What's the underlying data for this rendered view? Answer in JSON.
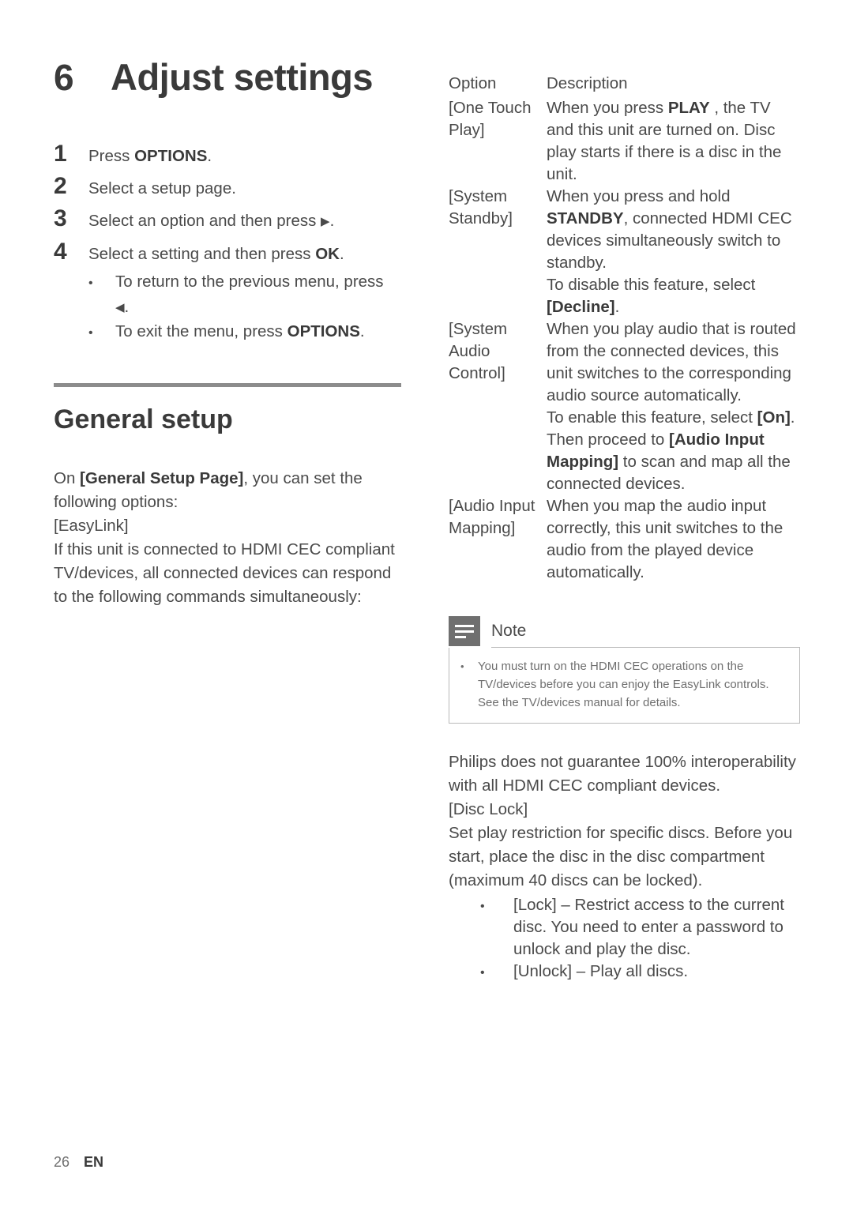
{
  "chapter": {
    "number": "6",
    "title": "Adjust settings"
  },
  "steps": [
    {
      "num": "1",
      "text_before": "Press ",
      "bold": "OPTIONS",
      "text_after": "."
    },
    {
      "num": "2",
      "text_before": "Select a setup page.",
      "bold": "",
      "text_after": ""
    },
    {
      "num": "3",
      "text_before": "Select an option and then press ",
      "bold": "",
      "text_after": "."
    },
    {
      "num": "4",
      "text_before": "Select a setting and then press ",
      "bold": "OK",
      "text_after": "."
    }
  ],
  "step_bullets": [
    {
      "text": "To return to the previous menu, press",
      "second_line": "."
    },
    {
      "text_before": "To exit the menu, press ",
      "bold": "OPTIONS",
      "text_after": "."
    }
  ],
  "section": {
    "title": "General setup",
    "intro_before": "On ",
    "intro_bold": "[General Setup Page]",
    "intro_after": ", you can set the following options:",
    "easylink_label": "[EasyLink]",
    "easylink_body": "If this unit is connected to HDMI CEC compliant TV/devices, all connected devices can respond to the following commands simultaneously:"
  },
  "option_table": {
    "headers": [
      "Option",
      "Description"
    ],
    "rows": [
      {
        "option": "[One Touch Play]",
        "description_parts": [
          {
            "t": "When you press ",
            "b": false
          },
          {
            "t": "PLAY",
            "b": true
          },
          {
            "t": " , the TV and this unit are turned on. Disc play starts if there is a disc in the unit.",
            "b": false
          }
        ]
      },
      {
        "option": "[System Standby]",
        "description_parts": [
          {
            "t": "When you press and hold ",
            "b": false
          },
          {
            "t": "STANDBY",
            "b": true
          },
          {
            "t": ", connected HDMI CEC devices simultaneously switch to standby.",
            "b": false
          },
          {
            "t": "\nTo disable this feature, select ",
            "b": false
          },
          {
            "t": "[Decline]",
            "b": true
          },
          {
            "t": ".",
            "b": false
          }
        ]
      },
      {
        "option": "[System Audio Control]",
        "description_parts": [
          {
            "t": "When you play audio that is routed from the connected devices, this unit switches to the corresponding audio source automatically.",
            "b": false
          },
          {
            "t": "\nTo enable this feature, select ",
            "b": false
          },
          {
            "t": "[On]",
            "b": true
          },
          {
            "t": ". Then proceed to ",
            "b": false
          },
          {
            "t": "[Audio Input Mapping]",
            "b": true
          },
          {
            "t": " to scan and map all the connected devices.",
            "b": false
          }
        ]
      },
      {
        "option": "[Audio Input Mapping]",
        "description_parts": [
          {
            "t": "When you map the audio input correctly, this unit switches to the audio from the played device automatically.",
            "b": false
          }
        ]
      }
    ]
  },
  "note": {
    "title": "Note",
    "icon": "note-lines-icon",
    "items": [
      "You must turn on the HDMI CEC operations on the TV/devices before you can enjoy the EasyLink controls. See the TV/devices manual for details."
    ]
  },
  "after_note": {
    "paragraph": "Philips does not guarantee 100% interoperability with all HDMI CEC compliant devices.",
    "disc_lock_label": "[Disc Lock]",
    "disc_lock_body": "Set play restriction for specific discs. Before you start, place the disc in the disc compartment (maximum 40 discs can be locked).",
    "bullets": [
      {
        "bold": "[Lock]",
        "rest": " – Restrict access to the current disc. You need to enter a password to unlock and play the disc."
      },
      {
        "bold": "[Unlock]",
        "rest": " – Play all discs."
      }
    ]
  },
  "footer": {
    "page_number": "26",
    "language": "EN"
  },
  "colors": {
    "body_text": "#4a4a4a",
    "heading_text": "#3a3a3a",
    "rule": "#8c8c8c",
    "note_gray": "#6f6f6f",
    "note_border": "#b9b9b9"
  }
}
